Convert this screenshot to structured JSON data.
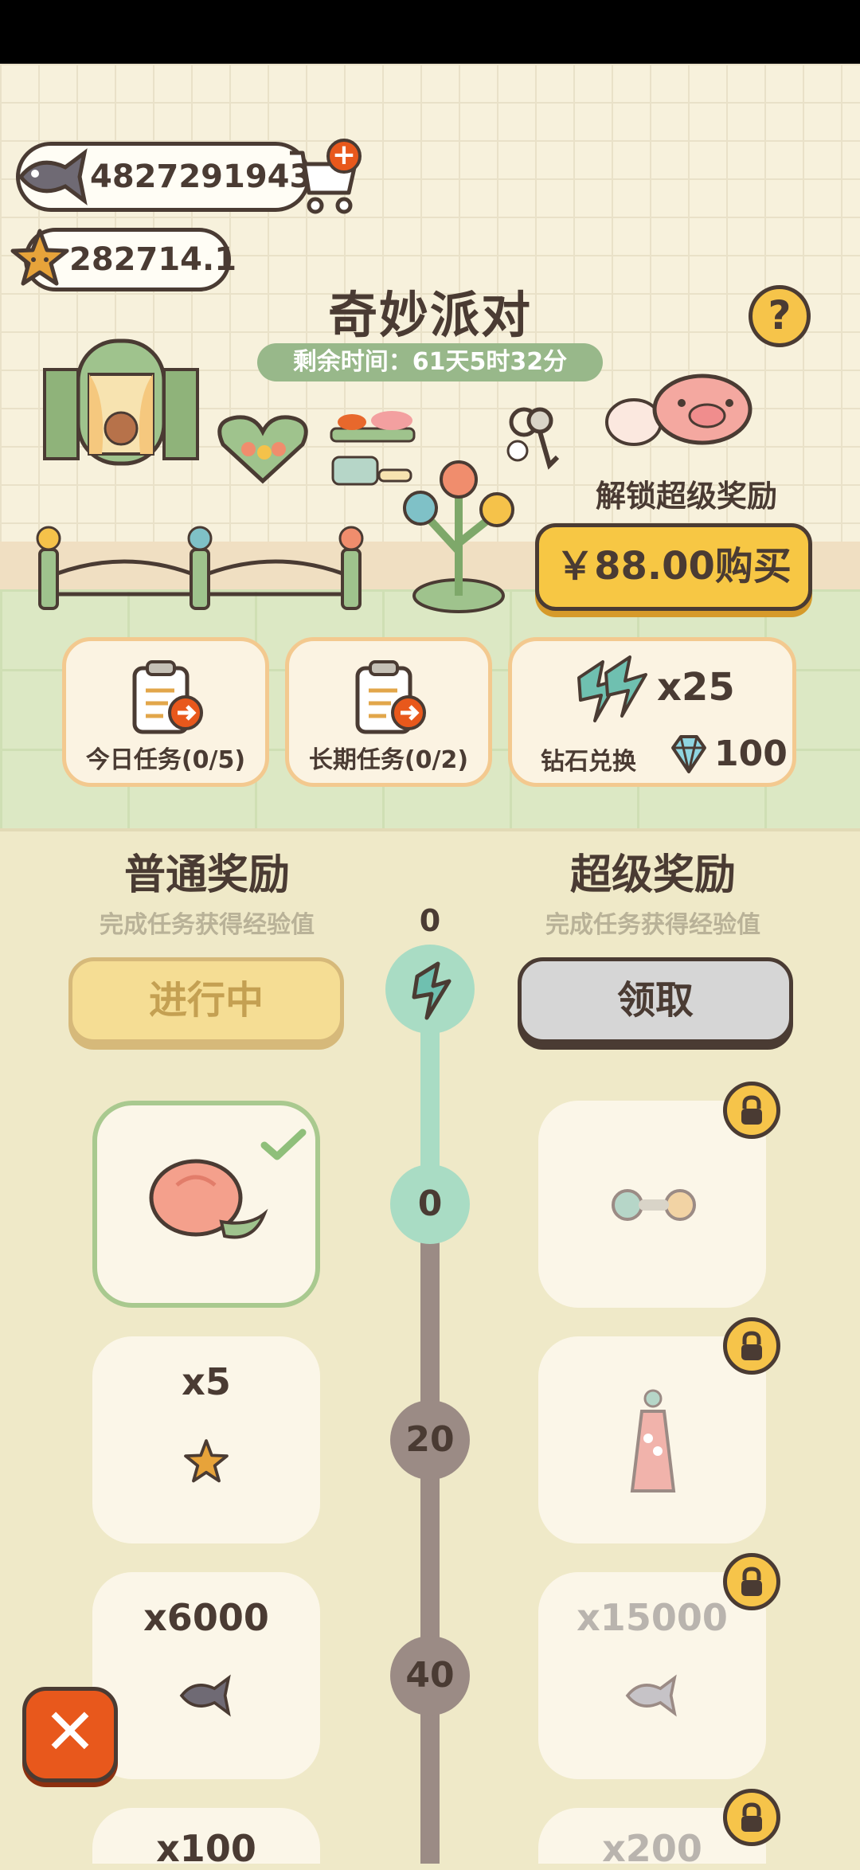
{
  "currency": {
    "fish_amount": "4827291943",
    "star_amount": "282714.1"
  },
  "event": {
    "title": "奇妙派对",
    "timer_text": "剩余时间：61天5时32分",
    "unlock_label": "解锁超级奖励",
    "buy_label": "￥88.00购买",
    "help_symbol": "?"
  },
  "task_cards": [
    {
      "label": "今日任务(0/5)"
    },
    {
      "label": "长期任务(0/2)"
    }
  ],
  "diamond_exchange": {
    "count": "x25",
    "label": "钻石兑换",
    "price": "100"
  },
  "columns": {
    "normal": {
      "title": "普通奖励",
      "subtitle": "完成任务获得经验值",
      "button": "进行中"
    },
    "super": {
      "title": "超级奖励",
      "subtitle": "完成任务获得经验值",
      "button": "领取"
    },
    "current_exp": "0"
  },
  "levels": [
    {
      "level": "0",
      "normal": {
        "label": "",
        "item": "tulip-bouquet",
        "claimed": true
      },
      "super": {
        "label": "",
        "item": "flower-hairclip",
        "locked": true
      }
    },
    {
      "level": "20",
      "normal": {
        "label": "x5",
        "item": "star"
      },
      "super": {
        "label": "",
        "item": "pink-dress",
        "locked": true
      }
    },
    {
      "level": "40",
      "normal": {
        "label": "x6000",
        "item": "fish"
      },
      "super": {
        "label": "x15000",
        "item": "fish",
        "locked": true
      }
    },
    {
      "level": "",
      "normal": {
        "label": "x100",
        "item": ""
      },
      "super": {
        "label": "x200",
        "item": "",
        "locked": true
      }
    }
  ],
  "close_symbol": "✕",
  "colors": {
    "accent_yellow": "#f7c744",
    "outline_brown": "#4a3b33",
    "mint_progress": "#a9dcc4",
    "track_gray": "#9b8b85",
    "timer_green": "#98b88a",
    "close_orange": "#e8581c"
  }
}
